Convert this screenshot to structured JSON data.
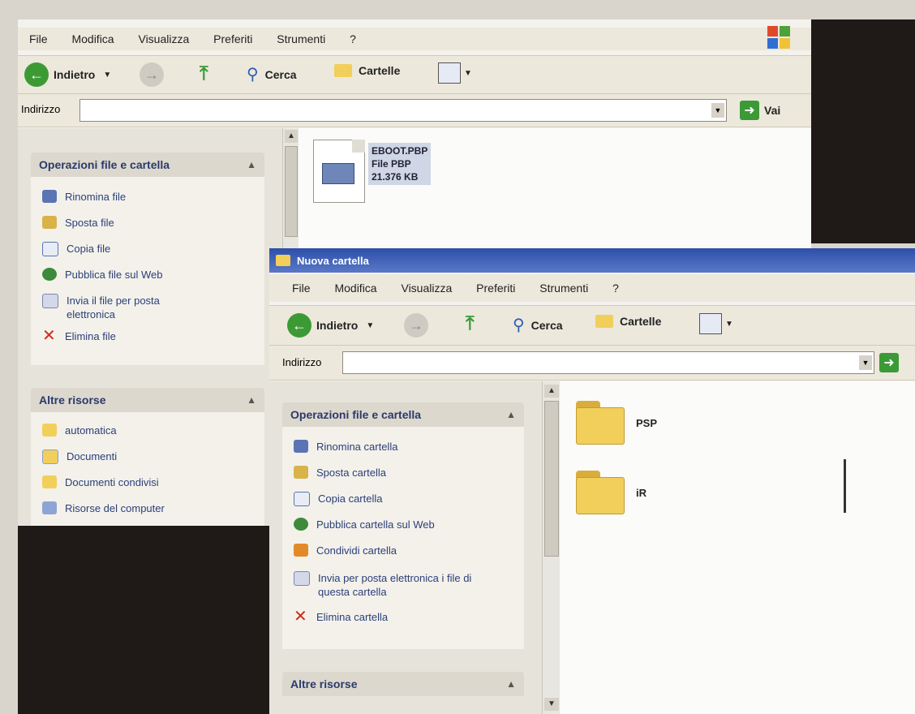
{
  "window_back": {
    "menu": [
      "File",
      "Modifica",
      "Visualizza",
      "Preferiti",
      "Strumenti",
      "?"
    ],
    "toolbar": {
      "back_label": "Indietro",
      "search_label": "Cerca",
      "folders_label": "Cartelle"
    },
    "address": {
      "label": "Indirizzo",
      "value": "",
      "go_label": "Vai"
    },
    "tasks_panel": {
      "title": "Operazioni file e cartella",
      "items": [
        "Rinomina file",
        "Sposta file",
        "Copia file",
        "Pubblica file sul Web",
        "Invia il file per posta elettronica",
        "Elimina file"
      ]
    },
    "other_panel": {
      "title": "Altre risorse",
      "items": [
        "automatica",
        "Documenti",
        "Documenti condivisi",
        "Risorse del computer"
      ]
    },
    "file": {
      "name": "EBOOT.PBP",
      "type": "File PBP",
      "size": "21.376 KB"
    }
  },
  "window_front": {
    "title": "Nuova cartella",
    "menu": [
      "File",
      "Modifica",
      "Visualizza",
      "Preferiti",
      "Strumenti",
      "?"
    ],
    "toolbar": {
      "back_label": "Indietro",
      "search_label": "Cerca",
      "folders_label": "Cartelle"
    },
    "address": {
      "label": "Indirizzo",
      "value": ""
    },
    "tasks_panel": {
      "title": "Operazioni file e cartella",
      "items": [
        "Rinomina cartella",
        "Sposta cartella",
        "Copia cartella",
        "Pubblica cartella sul Web",
        "Condividi cartella",
        "Invia per posta elettronica i file di questa cartella",
        "Elimina cartella"
      ]
    },
    "other_panel": {
      "title": "Altre risorse"
    },
    "folders": [
      "PSP",
      "iR"
    ]
  },
  "colors": {
    "titlebar": "#2d4fa8",
    "link_text": "#2b3f7a",
    "folder": "#f1cf5a"
  }
}
